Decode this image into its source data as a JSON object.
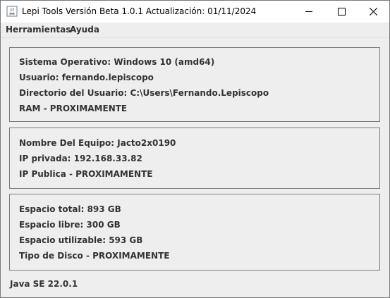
{
  "window": {
    "title": "Lepi Tools Versión Beta 1.0.1 Actualización: 01/11/2024",
    "icon": "java-app-icon",
    "controls": [
      "minimize-icon",
      "maximize-icon",
      "close-icon"
    ]
  },
  "menu": {
    "items": [
      {
        "label": "Herramientas"
      },
      {
        "label": "Ayuda"
      }
    ]
  },
  "system_panel": {
    "rows": [
      "Sistema Operativo: Windows 10 (amd64)",
      "Usuario: fernando.lepiscopo",
      "Directorio del Usuario: C:\\Users\\Fernando.Lepiscopo",
      "RAM - PROXIMAMENTE"
    ]
  },
  "network_panel": {
    "rows": [
      "Nombre Del Equipo: Jacto2x0190",
      "IP privada: 192.168.33.82",
      "IP Publica - PROXIMAMENTE"
    ]
  },
  "disk_panel": {
    "rows": [
      "Espacio total: 893 GB",
      "Espacio libre: 300 GB",
      "Espacio utilizable: 593 GB",
      "Tipo de Disco - PROXIMAMENTE"
    ]
  },
  "footer": {
    "java_version": "Java SE 22.0.1"
  }
}
